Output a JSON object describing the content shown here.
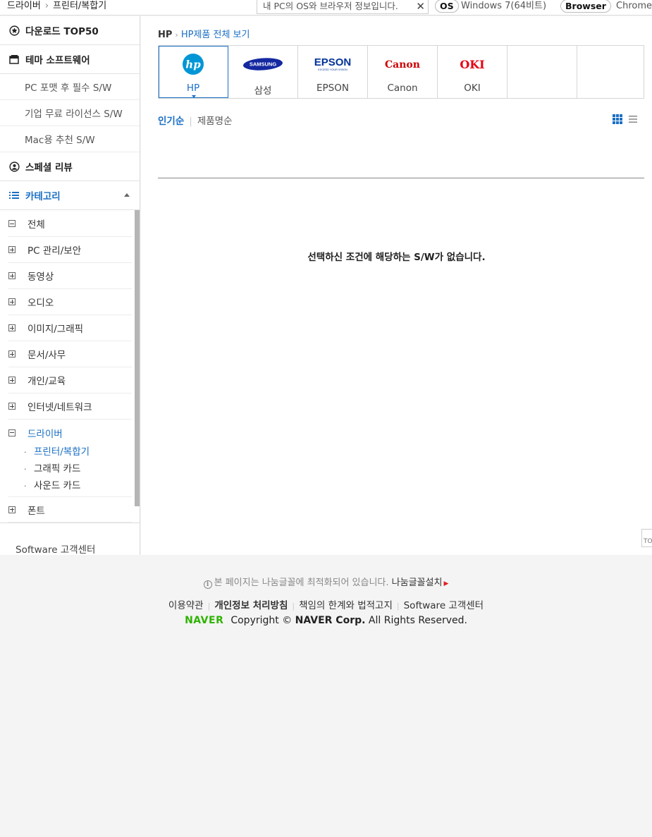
{
  "topbar": {
    "crumb1": "드라이버",
    "crumb2": "프린터/복합기",
    "os_note": "내 PC의 OS와 브라우저 정보입니다.",
    "os_label": "OS",
    "os_value": "Windows 7(64비트)",
    "browser_label": "Browser",
    "browser_value": "Chrome"
  },
  "sidebar": {
    "top50": "다운로드 TOP50",
    "theme": "테마 소프트웨어",
    "theme_items": [
      "PC 포맷 후 필수 S/W",
      "기업 무료 라이선스 S/W",
      "Mac용 추천 S/W"
    ],
    "special": "스페셜 리뷰",
    "category": "카테고리",
    "categories": [
      "전체",
      "PC 관리/보안",
      "동영상",
      "오디오",
      "이미지/그래픽",
      "문서/사무",
      "개인/교육",
      "인터넷/네트워크",
      "드라이버"
    ],
    "driver_sub": [
      "프린터/복합기",
      "그래픽 카드",
      "사운드 카드"
    ],
    "font": "폰트",
    "support": "Software 고객센터"
  },
  "main": {
    "bc_brand": "HP",
    "bc_link": "HP제품 전체 보기",
    "brands": [
      {
        "name": "HP",
        "logo": "hp-logo"
      },
      {
        "name": "삼성",
        "logo": "samsung-logo"
      },
      {
        "name": "EPSON",
        "logo": "epson-logo"
      },
      {
        "name": "Canon",
        "logo": "canon-logo"
      },
      {
        "name": "OKI",
        "logo": "oki-logo"
      }
    ],
    "logo_text": {
      "samsung": "SAMSUNG",
      "epson": "EPSON",
      "epson_tag": "EXCEED YOUR VISION",
      "canon": "Canon",
      "oki": "OKI",
      "hp": "hp"
    },
    "sort_popular": "인기순",
    "sort_name": "제품명순",
    "empty_msg": "선택하신 조건에 해당하는 S/W가 없습니다.",
    "top_button": "TO"
  },
  "footer": {
    "font_note": "본 페이지는 나눔글꼴에 최적화되어 있습니다.",
    "font_install": "나눔글꼴설치",
    "links": [
      "이용약관",
      "개인정보 처리방침",
      "책임의 한계와 법적고지",
      "Software 고객센터"
    ],
    "naver": "NAVER",
    "copyright_pre": "Copyright © ",
    "copyright_corp": "NAVER Corp.",
    "copyright_post": " All Rights Reserved."
  },
  "colors": {
    "accent": "#1a6fc4",
    "hp": "#0096d6",
    "samsung": "#1428a0",
    "epson": "#003399",
    "canon": "#cc0000",
    "oki": "#e60012",
    "naver": "#2db400"
  }
}
